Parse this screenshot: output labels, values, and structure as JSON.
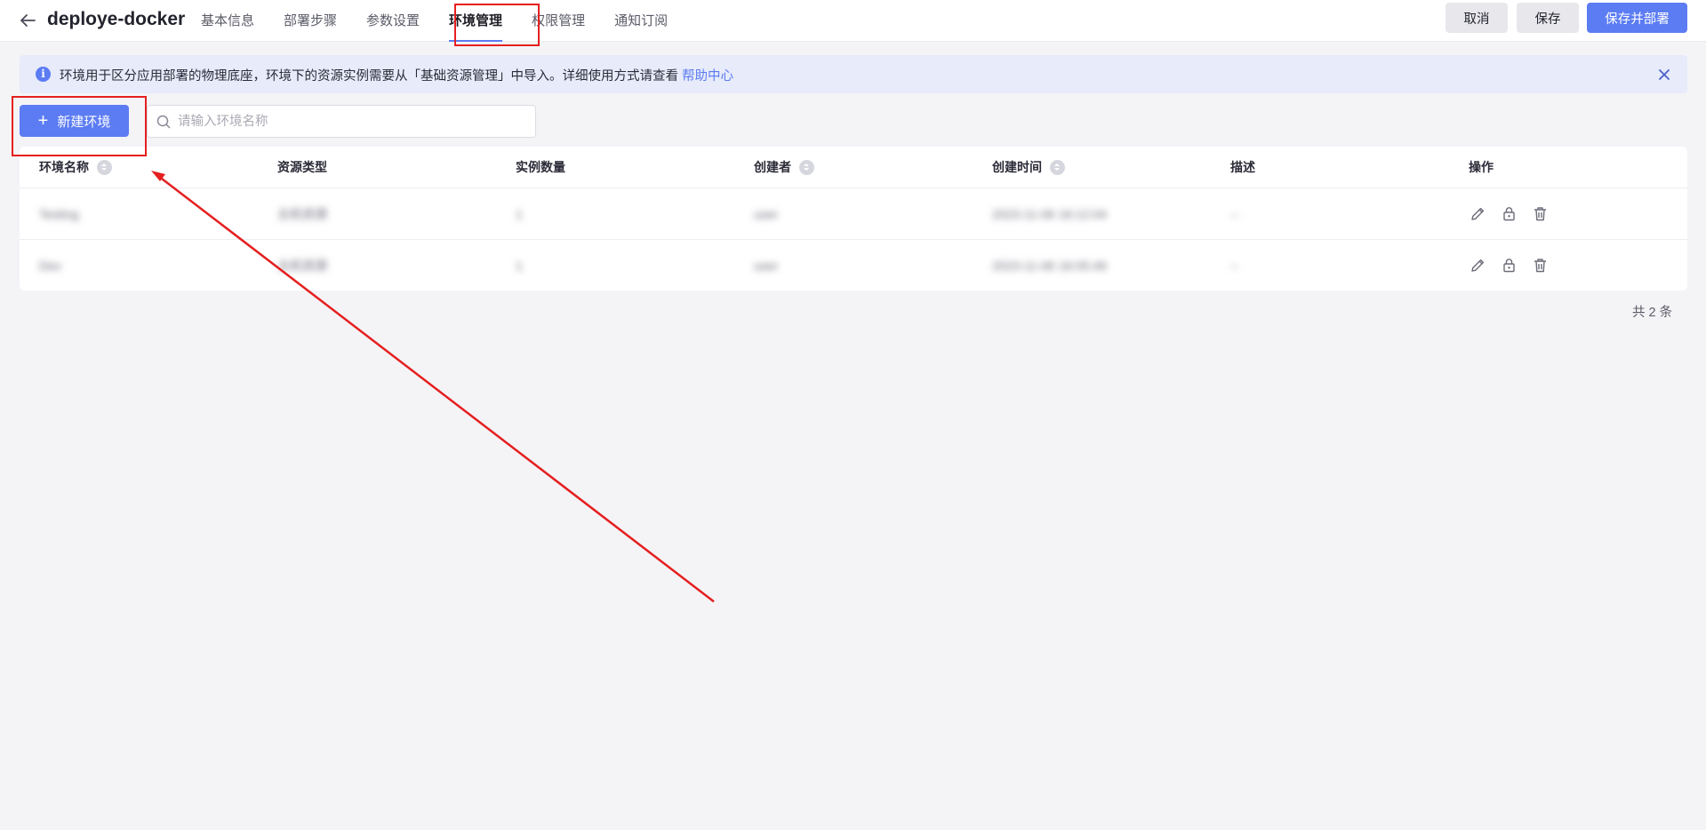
{
  "header": {
    "app_title": "deploye-docker",
    "tabs": [
      {
        "label": "基本信息"
      },
      {
        "label": "部署步骤"
      },
      {
        "label": "参数设置"
      },
      {
        "label": "环境管理"
      },
      {
        "label": "权限管理"
      },
      {
        "label": "通知订阅"
      }
    ],
    "active_tab": "环境管理",
    "cancel_label": "取消",
    "save_label": "保存",
    "save_deploy_label": "保存并部署"
  },
  "banner": {
    "message": "环境用于区分应用部署的物理底座，环境下的资源实例需要从「基础资源管理」中导入。详细使用方式请查看",
    "link_text": "帮助中心"
  },
  "toolbar": {
    "new_button_label": "新建环境",
    "search_placeholder": "请输入环境名称"
  },
  "table": {
    "columns": [
      "环境名称",
      "资源类型",
      "实例数量",
      "创建者",
      "创建时间",
      "描述",
      "操作"
    ],
    "rows": [
      {
        "name": "Testing",
        "resource_type": "主机资源",
        "count": "1",
        "creator": "user",
        "created_at": "2023-11-06 16:12:04",
        "description": "--"
      },
      {
        "name": "Dev",
        "resource_type": "主机资源",
        "count": "1",
        "creator": "user",
        "created_at": "2023-11-06 16:05:49",
        "description": "--"
      }
    ]
  },
  "footer": {
    "total_label": "共 2 条"
  },
  "colors": {
    "accent": "#5c7cf3",
    "annotation": "#e51f1f",
    "banner_bg": "#e7ebfa"
  },
  "icons": [
    "arrow-left-icon",
    "info-icon",
    "close-icon",
    "plus-icon",
    "search-icon",
    "sort-icon",
    "edit-icon",
    "lock-icon",
    "delete-icon"
  ]
}
